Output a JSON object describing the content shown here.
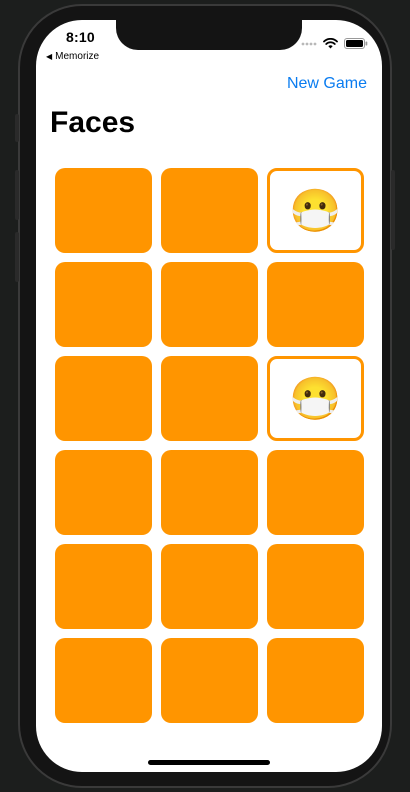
{
  "status_bar": {
    "time": "8:10",
    "back_app": "Memorize"
  },
  "nav": {
    "new_game_label": "New Game",
    "title": "Faces"
  },
  "cards": [
    {
      "face_up": false,
      "content": ""
    },
    {
      "face_up": false,
      "content": ""
    },
    {
      "face_up": true,
      "content": "😷"
    },
    {
      "face_up": false,
      "content": ""
    },
    {
      "face_up": false,
      "content": ""
    },
    {
      "face_up": false,
      "content": ""
    },
    {
      "face_up": false,
      "content": ""
    },
    {
      "face_up": false,
      "content": ""
    },
    {
      "face_up": true,
      "content": "😷"
    },
    {
      "face_up": false,
      "content": ""
    },
    {
      "face_up": false,
      "content": ""
    },
    {
      "face_up": false,
      "content": ""
    },
    {
      "face_up": false,
      "content": ""
    },
    {
      "face_up": false,
      "content": ""
    },
    {
      "face_up": false,
      "content": ""
    },
    {
      "face_up": false,
      "content": ""
    },
    {
      "face_up": false,
      "content": ""
    },
    {
      "face_up": false,
      "content": ""
    }
  ],
  "theme": {
    "card_color": "#ff9500",
    "link_color": "#0a7cf0"
  },
  "icons": {
    "back": "back-chevron-icon",
    "cellular": "cellular-signal-icon",
    "wifi": "wifi-icon",
    "battery": "battery-icon"
  }
}
